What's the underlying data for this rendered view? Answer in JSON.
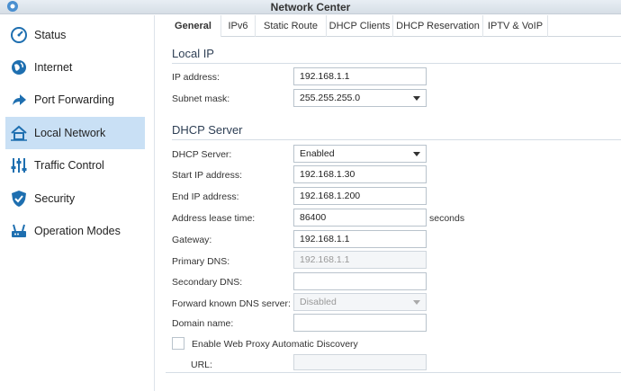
{
  "window": {
    "title": "Network Center"
  },
  "sidebar": {
    "items": [
      {
        "label": "Status",
        "icon": "gauge-icon"
      },
      {
        "label": "Internet",
        "icon": "globe-icon"
      },
      {
        "label": "Port Forwarding",
        "icon": "forward-arrow-icon"
      },
      {
        "label": "Local Network",
        "icon": "home-network-icon",
        "active": true
      },
      {
        "label": "Traffic Control",
        "icon": "sliders-icon"
      },
      {
        "label": "Security",
        "icon": "shield-icon"
      },
      {
        "label": "Operation Modes",
        "icon": "router-icon"
      }
    ]
  },
  "tabs": [
    {
      "label": "General",
      "active": true
    },
    {
      "label": "IPv6"
    },
    {
      "label": "Static Route"
    },
    {
      "label": "DHCP Clients"
    },
    {
      "label": "DHCP Reservation"
    },
    {
      "label": "IPTV & VoIP"
    }
  ],
  "local_ip": {
    "heading": "Local IP",
    "ip_address": {
      "label": "IP address:",
      "value": "192.168.1.1"
    },
    "subnet_mask": {
      "label": "Subnet mask:",
      "value": "255.255.255.0"
    }
  },
  "dhcp": {
    "heading": "DHCP Server",
    "server": {
      "label": "DHCP Server:",
      "value": "Enabled"
    },
    "start_ip": {
      "label": "Start IP address:",
      "value": "192.168.1.30"
    },
    "end_ip": {
      "label": "End IP address:",
      "value": "192.168.1.200"
    },
    "lease_time": {
      "label": "Address lease time:",
      "value": "86400",
      "unit": "seconds"
    },
    "gateway": {
      "label": "Gateway:",
      "value": "192.168.1.1"
    },
    "primary_dns": {
      "label": "Primary DNS:",
      "value": "192.168.1.1"
    },
    "secondary_dns": {
      "label": "Secondary DNS:",
      "value": ""
    },
    "forward_dns": {
      "label": "Forward known DNS server:",
      "value": "Disabled"
    },
    "domain_name": {
      "label": "Domain name:",
      "value": ""
    },
    "wpad": {
      "label": "Enable Web Proxy Automatic Discovery",
      "checked": false
    },
    "url": {
      "label": "URL:",
      "value": ""
    }
  },
  "colors": {
    "accent": "#c9e0f5",
    "heading": "#2e3f55",
    "icon_blue": "#1e6fb0"
  }
}
